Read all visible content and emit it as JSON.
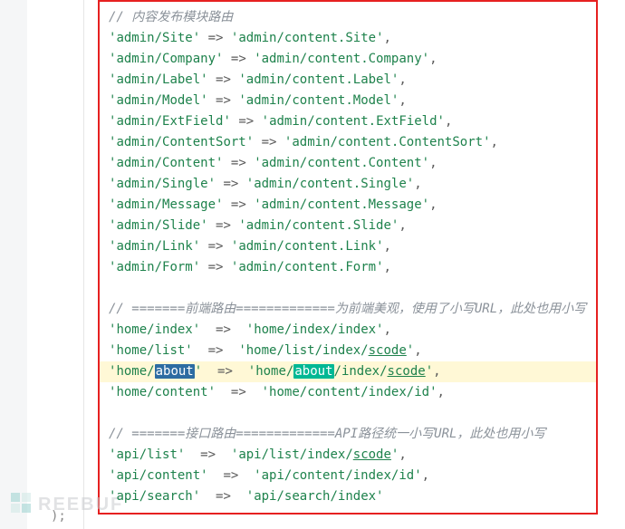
{
  "comments": {
    "content_module": "内容发布模块路由",
    "frontend": " =======前端路由=============为前端美观，使用了小写URL，此处也用小写",
    "api": " =======接口路由=============API路径统一小写URL，此处也用小写"
  },
  "content_routes": [
    {
      "k": "admin/Site",
      "v": "admin/content.Site"
    },
    {
      "k": "admin/Company",
      "v": "admin/content.Company"
    },
    {
      "k": "admin/Label",
      "v": "admin/content.Label"
    },
    {
      "k": "admin/Model",
      "v": "admin/content.Model"
    },
    {
      "k": "admin/ExtField",
      "v": "admin/content.ExtField"
    },
    {
      "k": "admin/ContentSort",
      "v": "admin/content.ContentSort"
    },
    {
      "k": "admin/Content",
      "v": "admin/content.Content"
    },
    {
      "k": "admin/Single",
      "v": "admin/content.Single"
    },
    {
      "k": "admin/Message",
      "v": "admin/content.Message"
    },
    {
      "k": "admin/Slide",
      "v": "admin/content.Slide"
    },
    {
      "k": "admin/Link",
      "v": "admin/content.Link"
    },
    {
      "k": "admin/Form",
      "v": "admin/content.Form"
    }
  ],
  "frontend_routes": {
    "index": {
      "k": "home/index",
      "v": "home/index/index"
    },
    "list": {
      "k": "home/list",
      "v_prefix": "home/list/index/",
      "v_tail": "scode"
    },
    "about": {
      "k_prefix": "home/",
      "k_hl": "about",
      "v_prefix": "home/",
      "v_hl": "about",
      "v_mid": "/index/",
      "v_tail": "scode"
    },
    "content": {
      "k": "home/content",
      "v": "home/content/index/id"
    }
  },
  "api_routes": {
    "list": {
      "k": "api/list",
      "v_prefix": "api/list/index/",
      "v_tail": "scode"
    },
    "content": {
      "k": "api/content",
      "v": "api/content/index/id"
    },
    "search": {
      "k": "api/search",
      "v": "api/search/index"
    }
  },
  "arrow": "=>",
  "watermark": "REEBUF",
  "brace": ");"
}
